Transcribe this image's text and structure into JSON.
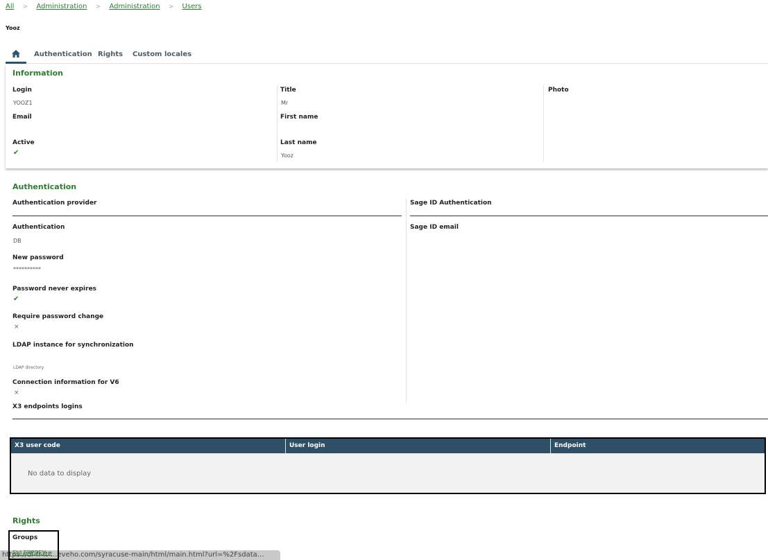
{
  "breadcrumb": {
    "items": [
      "All",
      "Administration",
      "Administration",
      "Users"
    ],
    "separator": ">"
  },
  "page": {
    "title": "Yooz"
  },
  "tabs": [
    {
      "icon": "home-icon",
      "label": ""
    },
    {
      "label": "Authentication"
    },
    {
      "label": "Rights"
    },
    {
      "label": "Custom locales"
    }
  ],
  "information": {
    "title": "Information",
    "login_label": "Login",
    "login_value": "YOOZ1",
    "email_label": "Email",
    "active_label": "Active",
    "title_label": "Title",
    "title_value": "Mr",
    "first_name_label": "First name",
    "last_name_label": "Last name",
    "last_name_value": "Yooz",
    "photo_label": "Photo"
  },
  "authentication": {
    "title": "Authentication",
    "provider_label": "Authentication provider",
    "authentication_label": "Authentication",
    "authentication_value": "DB",
    "new_password_label": "New password",
    "new_password_value": "**********",
    "password_never_expires_label": "Password never expires",
    "require_password_change_label": "Require password change",
    "ldap_label": "LDAP instance for synchronization",
    "ldap_placeholder": "LDAP directory",
    "connection_v6_label": "Connection information for V6",
    "sage_id_label": "Sage ID Authentication",
    "sage_id_email_label": "Sage ID email",
    "x3_logins_label": "X3 endpoints logins",
    "check_glyph": "✔",
    "cross_glyph": "×"
  },
  "x3_grid": {
    "columns": [
      "X3 user code",
      "User login",
      "Endpoint"
    ],
    "empty_text": "No data to display"
  },
  "rights": {
    "title": "Rights",
    "groups_label": "Groups",
    "group_value": "Std ERPDEV",
    "menu_glyph": "≡"
  },
  "status_bar": {
    "url_text": "https://dl-fr-it-…eveho.com/syracuse-main/html/main.html?url=%2Fsdata…"
  },
  "colors": {
    "accent_green": "#2e7d32",
    "grid_header": "#2f4f66",
    "tab_active": "#2a5671"
  }
}
